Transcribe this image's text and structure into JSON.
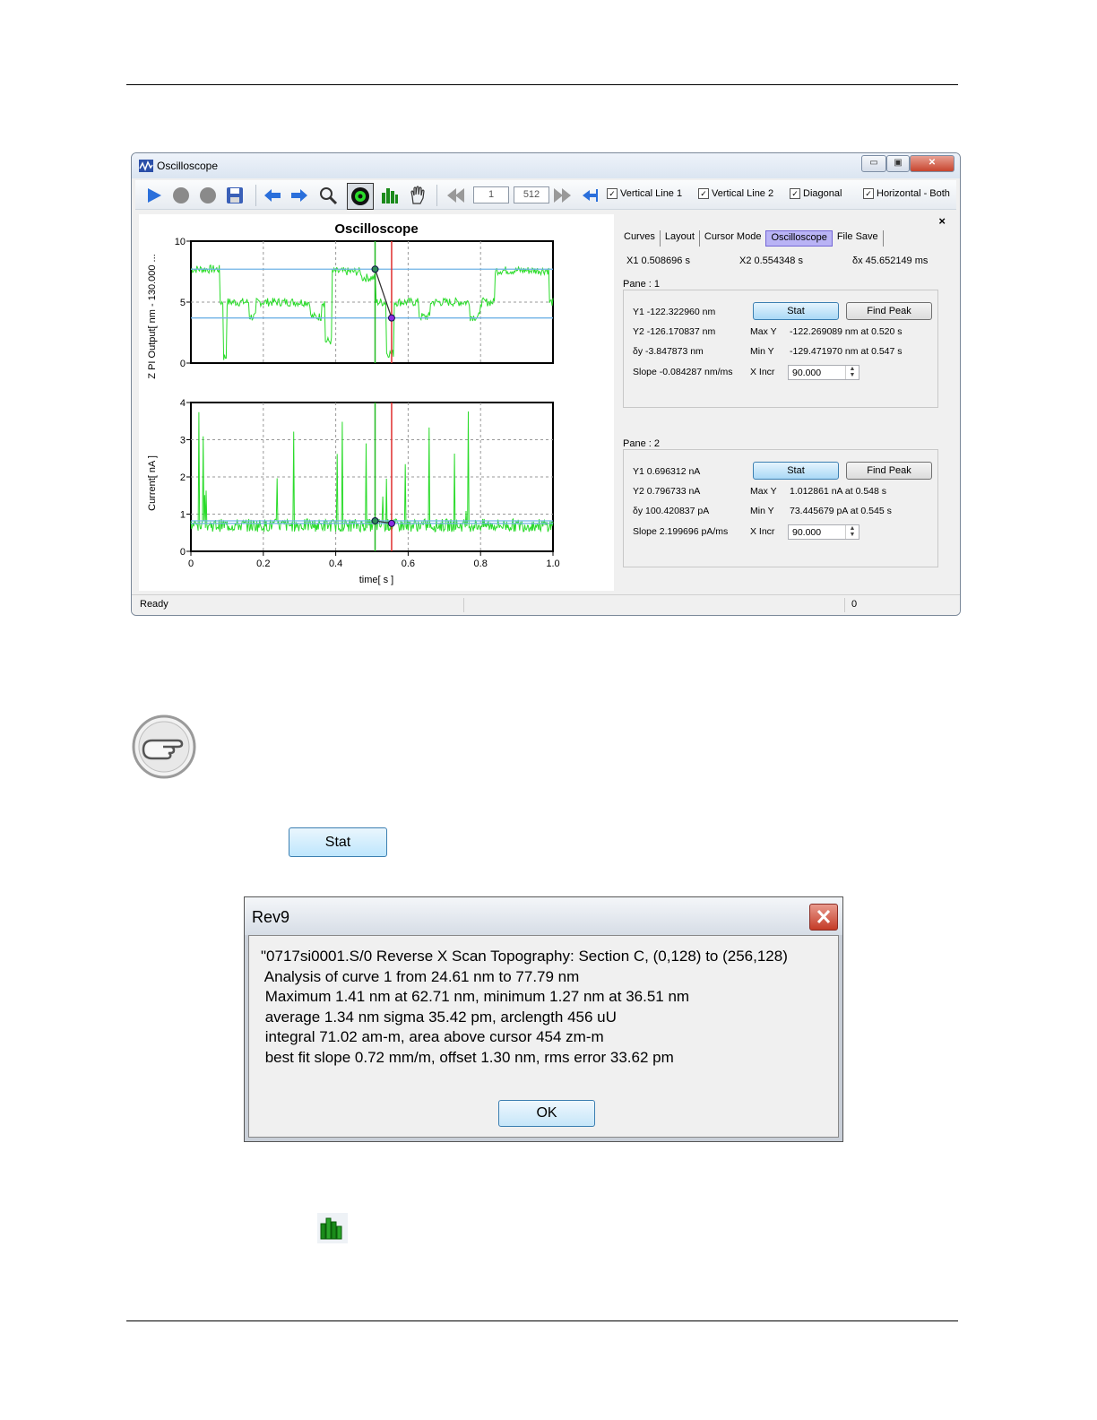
{
  "window": {
    "title": "Oscilloscope",
    "minimize": "▭",
    "maximize": "▣",
    "close": "✕"
  },
  "toolbar": {
    "page_current": "1",
    "page_total": "512",
    "checkboxes": [
      {
        "label": "Vertical Line 1",
        "checked": true
      },
      {
        "label": "Vertical Line 2",
        "checked": true
      },
      {
        "label": "Diagonal",
        "checked": true
      },
      {
        "label": "Horizontal - Both",
        "checked": true
      }
    ]
  },
  "chart_data": [
    {
      "type": "line",
      "title": "Oscilloscope",
      "ylabel": "Z PI Output[ nm - 130.000 ...",
      "ylim": [
        0,
        10
      ],
      "yticks": [
        "10",
        "5",
        "0"
      ],
      "xlim": [
        0,
        1.0
      ],
      "series": [],
      "cursors": {
        "x1": 0.508696,
        "x2": 0.554348
      }
    },
    {
      "type": "line",
      "xlabel": "time[ s ]",
      "ylabel": "Current[ nA ]",
      "ylim": [
        0,
        4
      ],
      "yticks": [
        "4",
        "3",
        "2",
        "1",
        "0"
      ],
      "xlim": [
        0,
        1.0
      ],
      "xticks": [
        "0",
        "0.2",
        "0.4",
        "0.6",
        "0.8",
        "1.0"
      ],
      "series": [],
      "cursors": {
        "x1": 0.508696,
        "x2": 0.554348
      }
    }
  ],
  "panel": {
    "tabs": [
      "Curves",
      "Layout",
      "Cursor Mode",
      "Oscilloscope",
      "File Save"
    ],
    "active_tab": "Oscilloscope",
    "close": "×",
    "x1": "X1  0.508696 s",
    "x2": "X2  0.554348 s",
    "dx": "δx  45.652149 ms",
    "panes": [
      {
        "label": "Pane :   1",
        "y1": "Y1    -122.322960 nm",
        "y2": "Y2    -126.170837 nm",
        "dy": "δy    -3.847873 nm",
        "slope": "Slope  -0.084287 nm/ms",
        "max_y_label": "Max Y",
        "max_y": "-122.269089 nm at 0.520 s",
        "min_y_label": "Min Y",
        "min_y": "-129.471970 nm at 0.547 s",
        "xincr_label": "X Incr",
        "xincr": "90.000",
        "stat": "Stat",
        "find_peak": "Find Peak"
      },
      {
        "label": "Pane :   2",
        "y1": "Y1    0.696312 nA",
        "y2": "Y2    0.796733 nA",
        "dy": "δy    100.420837 pA",
        "slope": "Slope  2.199696 pA/ms",
        "max_y_label": "Max Y",
        "max_y": "1.012861 nA at 0.548 s",
        "min_y_label": "Min Y",
        "min_y": "73.445679 pA at 0.545 s",
        "xincr_label": "X Incr",
        "xincr": "90.000",
        "stat": "Stat",
        "find_peak": "Find Peak"
      }
    ]
  },
  "status": {
    "left": "Ready",
    "right": "0"
  },
  "stat_button": "Stat",
  "dialog": {
    "title": "Rev9",
    "lines": [
      "\"0717si0001.S/0 Reverse X Scan Topography: Section C, (0,128) to (256,128)",
      " Analysis of curve 1 from 24.61 nm to 77.79 nm",
      " Maximum 1.41 nm at 62.71 nm, minimum 1.27 nm at 36.51 nm",
      " average 1.34 nm sigma 35.42 pm, arclength 456 uU",
      " integral 71.02 am-m, area above cursor 454 zm-m",
      " best fit slope 0.72 mm/m, offset 1.30 nm, rms error 33.62 pm"
    ],
    "ok": "OK"
  },
  "colors": {
    "trace": "#2adb2a",
    "cursor1": "#22bb22",
    "cursor2": "#e03030",
    "hline": "#6fb2e6",
    "active_tab": "#b9b3f5"
  }
}
